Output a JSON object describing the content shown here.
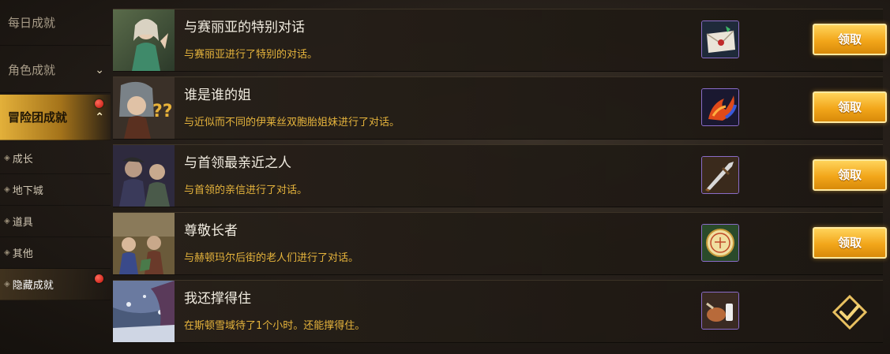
{
  "sidebar": {
    "categories": [
      {
        "label": "每日成就"
      },
      {
        "label": "角色成就"
      },
      {
        "label": "冒险团成就"
      }
    ],
    "sub_items": [
      {
        "label": "成长"
      },
      {
        "label": "地下城"
      },
      {
        "label": "道具"
      },
      {
        "label": "其他"
      },
      {
        "label": "隐藏成就"
      }
    ]
  },
  "achievements": [
    {
      "title": "与赛丽亚的特别对话",
      "description": "与赛丽亚进行了特别的对话。",
      "reward_icon": "letter-icon",
      "status": "claimable",
      "button_label": "领取"
    },
    {
      "title": "谁是谁的姐",
      "description": "与近似而不同的伊莱丝双胞胎姐妹进行了对话。",
      "reward_icon": "fire-swirl-icon",
      "status": "claimable",
      "button_label": "领取"
    },
    {
      "title": "与首领最亲近之人",
      "description": "与首领的亲信进行了对话。",
      "reward_icon": "sword-icon",
      "status": "claimable",
      "button_label": "领取"
    },
    {
      "title": "尊敬长者",
      "description": "与赫顿玛尔后街的老人们进行了对话。",
      "reward_icon": "badge-icon",
      "status": "claimable",
      "button_label": "领取"
    },
    {
      "title": "我还撑得住",
      "description": "在斯顿雪域待了1个小时。还能撑得住。",
      "reward_icon": "food-icon",
      "status": "completed",
      "button_label": ""
    }
  ],
  "colors": {
    "accent_gold": "#e3b03a",
    "desc_text": "#e6b43c",
    "notification_red": "#c1120a"
  }
}
